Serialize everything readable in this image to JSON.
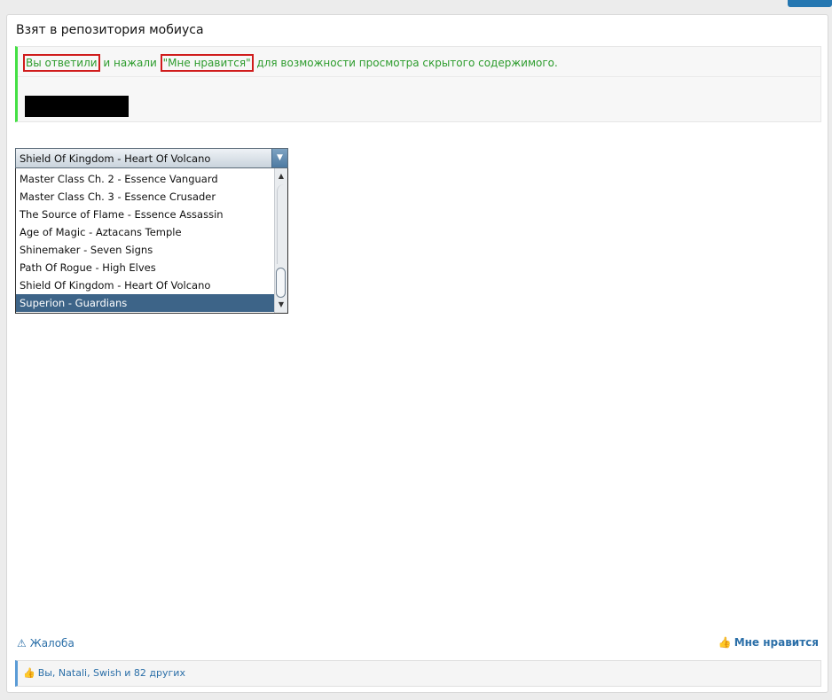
{
  "post": {
    "title": "Взят в репозитория мобиуса"
  },
  "hidden_content": {
    "replied": "Вы ответили",
    "and_pressed": " и нажали ",
    "like_quote": "\"Мне нравится\"",
    "suffix": " для возможности просмотра скрытого содержимого."
  },
  "dropdown": {
    "selected_value": "Shield Of Kingdom - Heart Of Volcano",
    "options": [
      "Master Class Ch. 2 - Essence Vanguard",
      "Master Class Ch. 3 - Essence Crusader",
      "The Source of Flame - Essence Assassin",
      "Age of Magic - Aztacans Temple",
      "Shinemaker - Seven Signs",
      "Path Of Rogue - High Elves",
      "Shield Of Kingdom - Heart Of Volcano",
      "Superion - Guardians"
    ],
    "highlighted_index": 7
  },
  "footer": {
    "report_label": "Жалоба",
    "like_label": "Мне нравится",
    "likes_summary": "Вы, Natali, Swish и 82 других"
  },
  "icons": {
    "report": "warning-triangle-icon",
    "like": "thumbs-up-icon",
    "dropdown_arrow": "chevron-down-icon"
  },
  "colors": {
    "accent_blue": "#2b6fa8",
    "notice_green": "#2d9c2d",
    "highlight_red": "#d01c1c",
    "selected_option": "#3d6488"
  }
}
